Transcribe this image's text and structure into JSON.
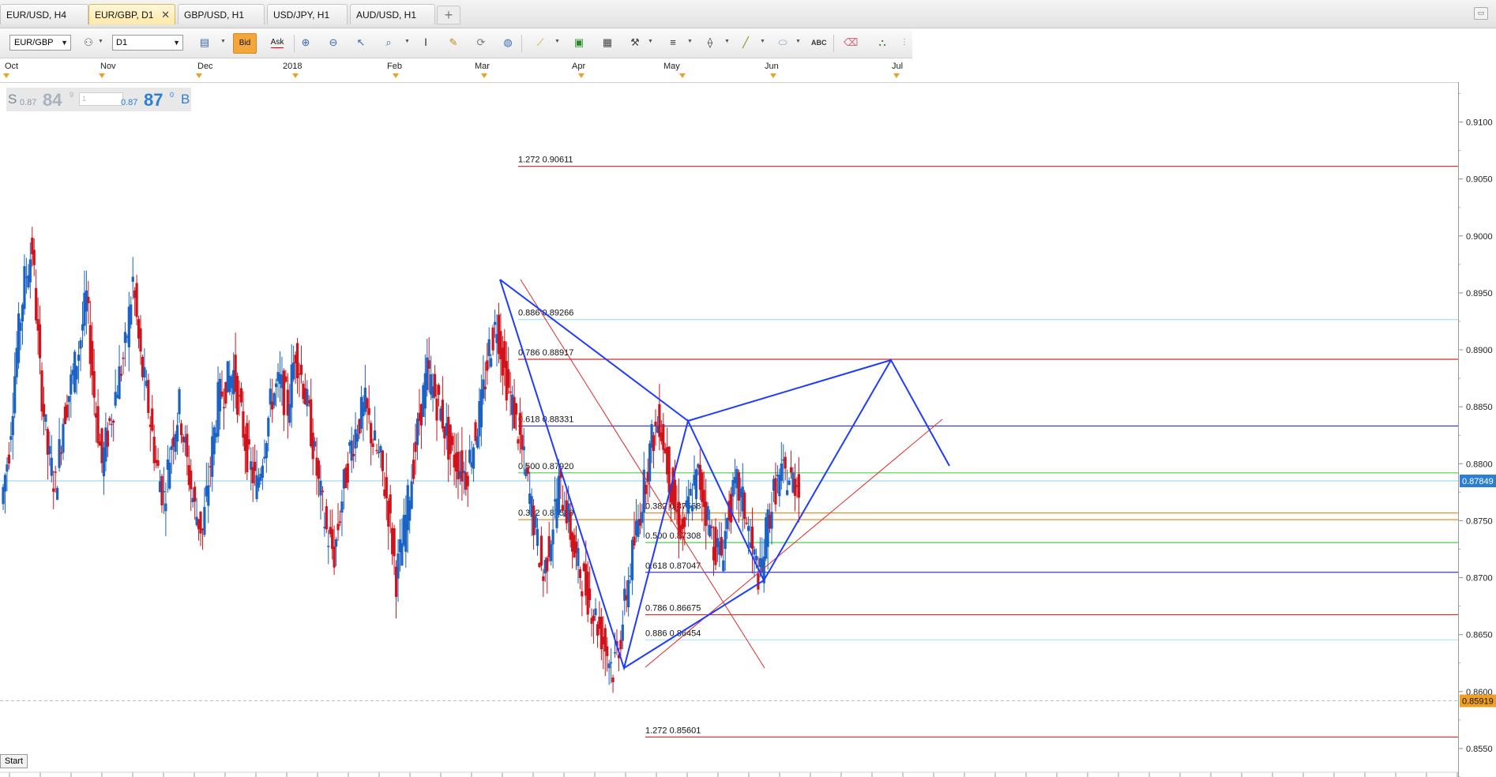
{
  "tabs": [
    {
      "label": "EUR/USD, H4",
      "active": false
    },
    {
      "label": "EUR/GBP, D1",
      "active": true
    },
    {
      "label": "GBP/USD, H1",
      "active": false
    },
    {
      "label": "USD/JPY, H1",
      "active": false
    },
    {
      "label": "AUD/USD, H1",
      "active": false
    }
  ],
  "tab_close_glyph": "✕",
  "tab_add_glyph": "+",
  "toolbar": {
    "symbol": "EUR/GBP",
    "period": "D1",
    "bid_label": "Bid",
    "ask_label": "Ask"
  },
  "price_panel": {
    "sell_label": "S",
    "sell_small": "0.87",
    "sell_big": "84",
    "sell_sup": "9",
    "qty_placeholder": "1",
    "buy_small": "0.87",
    "buy_big": "87",
    "buy_sup": "0",
    "buy_label": "B"
  },
  "start_label": "Start",
  "colors": {
    "bull": "#1a62c4",
    "bear": "#d0121b",
    "pattern": "#1f3bff",
    "current_price_bg": "#2a7fd4",
    "marker_bg": "#f0a020"
  },
  "chart_data": {
    "type": "candlestick",
    "symbol": "EUR/GBP",
    "timeframe": "D1",
    "month_labels": [
      "Oct",
      "Nov",
      "Dec",
      "2018",
      "Feb",
      "Mar",
      "Apr",
      "May",
      "Jun",
      "Jul"
    ],
    "y_ticks": [
      "0.8550",
      "0.8600",
      "0.8650",
      "0.8700",
      "0.8750",
      "0.8800",
      "0.8850",
      "0.8900",
      "0.8950",
      "0.9000",
      "0.9050",
      "0.9100"
    ],
    "ylim": [
      0.8525,
      0.9135
    ],
    "current_price_label": "0.87849",
    "current_price": 0.87849,
    "marker_price_label": "0.85919",
    "marker_price": 0.85919,
    "fib_levels": [
      {
        "text": "1.272 0.90611",
        "price": 0.90611,
        "color": "#d23a3a",
        "group": "upper"
      },
      {
        "text": "0.886 0.89266",
        "price": 0.89266,
        "color": "#a9e3ee",
        "group": "upper"
      },
      {
        "text": "0.786 0.88917",
        "price": 0.88917,
        "color": "#d42a2a",
        "group": "upper"
      },
      {
        "text": "0.618 0.88331",
        "price": 0.88331,
        "color": "#3a3ac8",
        "group": "upper"
      },
      {
        "text": "0.500 0.87920",
        "price": 0.8792,
        "color": "#4ad24a",
        "group": "upper"
      },
      {
        "text": "0.382 0.87509",
        "price": 0.87509,
        "color": "#f08a2a",
        "group": "upper"
      },
      {
        "text": "0.382 0.87568",
        "price": 0.87568,
        "color": "#f08a2a",
        "group": "lower"
      },
      {
        "text": "0.500 0.87308",
        "price": 0.87308,
        "color": "#4ad24a",
        "group": "lower"
      },
      {
        "text": "0.618 0.87047",
        "price": 0.87047,
        "color": "#3a3ac8",
        "group": "lower"
      },
      {
        "text": "0.786 0.86675",
        "price": 0.86675,
        "color": "#d42a2a",
        "group": "lower"
      },
      {
        "text": "0.886 0.86454",
        "price": 0.86454,
        "color": "#a9e3ee",
        "group": "lower"
      },
      {
        "text": "1.272 0.85601",
        "price": 0.85601,
        "color": "#d23a3a",
        "group": "lower"
      }
    ],
    "candles_seed": [
      0.8765,
      0.8815,
      0.89,
      0.896,
      0.899,
      0.888,
      0.881,
      0.878,
      0.884,
      0.887,
      0.89,
      0.8945,
      0.886,
      0.88,
      0.8835,
      0.887,
      0.89,
      0.896,
      0.889,
      0.885,
      0.88,
      0.877,
      0.882,
      0.885,
      0.88,
      0.876,
      0.874,
      0.88,
      0.8855,
      0.887,
      0.888,
      0.884,
      0.88,
      0.878,
      0.882,
      0.886,
      0.887,
      0.885,
      0.89,
      0.887,
      0.883,
      0.878,
      0.874,
      0.872,
      0.877,
      0.881,
      0.8835,
      0.885,
      0.882,
      0.88,
      0.876,
      0.87,
      0.874,
      0.879,
      0.884,
      0.888,
      0.886,
      0.884,
      0.881,
      0.88,
      0.879,
      0.882,
      0.885,
      0.89,
      0.8925,
      0.888,
      0.885,
      0.882,
      0.878,
      0.874,
      0.87,
      0.874,
      0.878,
      0.876,
      0.872,
      0.87,
      0.868,
      0.866,
      0.864,
      0.862,
      0.865,
      0.87,
      0.874,
      0.878,
      0.882,
      0.884,
      0.88,
      0.876,
      0.874,
      0.877,
      0.879,
      0.876,
      0.873,
      0.872,
      0.876,
      0.878,
      0.876,
      0.872,
      0.87,
      0.875,
      0.878,
      0.879,
      0.8785
    ],
    "harmonic_pattern_points": [
      {
        "date": "early Mar",
        "price": 0.8967
      },
      {
        "date": "late Apr",
        "price": 0.862
      },
      {
        "date": "early May",
        "price": 0.8841
      },
      {
        "date": "early Jun",
        "price": 0.8699
      },
      {
        "date": "early Jul",
        "price": 0.8895
      },
      {
        "date": "mid Jul",
        "price": 0.88
      }
    ]
  }
}
